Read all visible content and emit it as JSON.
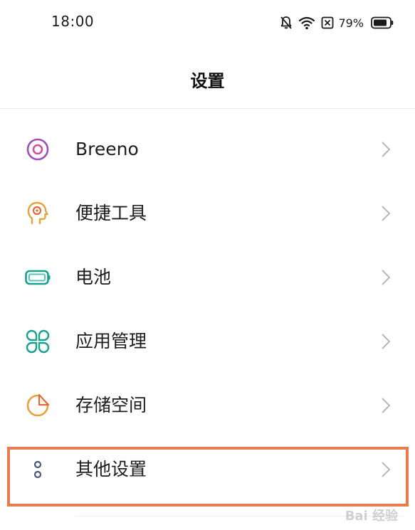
{
  "status_bar": {
    "time": "18:00",
    "battery_percent": "79%",
    "icons": [
      "bell-off-icon",
      "wifi-icon",
      "no-sim-icon",
      "battery-icon"
    ]
  },
  "header": {
    "title": "设置"
  },
  "settings": {
    "items": [
      {
        "label": "Breeno",
        "icon": "breeno-icon",
        "color": "#9b4fc0"
      },
      {
        "label": "便捷工具",
        "icon": "convenience-tools-icon",
        "color": "#e9a23b"
      },
      {
        "label": "电池",
        "icon": "battery-setting-icon",
        "color": "#1aa08f"
      },
      {
        "label": "应用管理",
        "icon": "app-management-icon",
        "color": "#1aa08f"
      },
      {
        "label": "存储空间",
        "icon": "storage-icon",
        "color": "#e9a23b"
      },
      {
        "label": "其他设置",
        "icon": "other-settings-icon",
        "color": "#4a5a7a"
      }
    ]
  },
  "highlight": {
    "color": "#ea7b4e"
  },
  "watermark": "Bai 经验"
}
